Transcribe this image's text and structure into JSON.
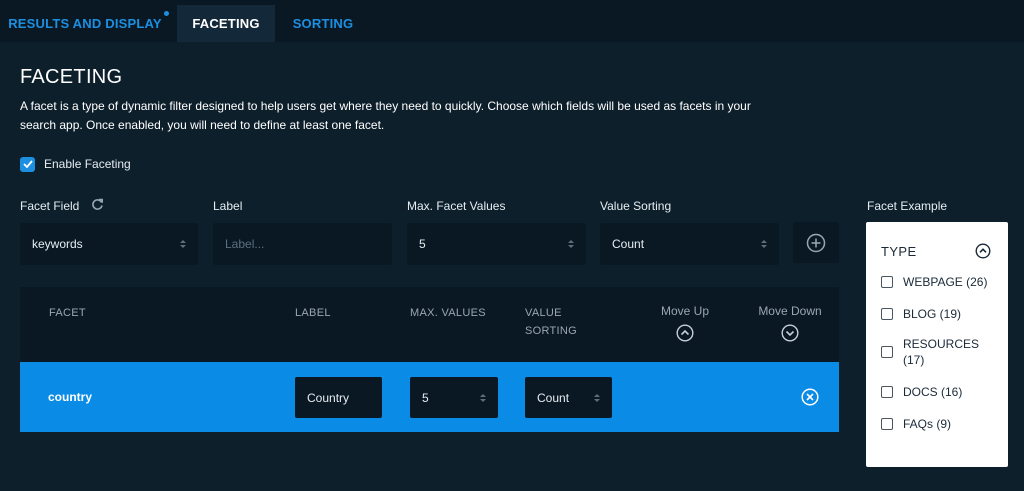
{
  "tabs": [
    {
      "label": "RESULTS AND DISPLAY",
      "has_indicator": true
    },
    {
      "label": "FACETING",
      "active": true
    },
    {
      "label": "SORTING"
    }
  ],
  "page": {
    "title": "FACETING",
    "description": "A facet is a type of dynamic filter designed to help users get where they need to quickly. Choose which fields will be used as facets in your search app. Once enabled, you will need to define at least one facet."
  },
  "enable": {
    "label": "Enable Faceting",
    "checked": true
  },
  "form": {
    "facet_field": {
      "label": "Facet Field",
      "value": "keywords"
    },
    "label": {
      "label": "Label",
      "placeholder": "Label..."
    },
    "max_values": {
      "label": "Max. Facet Values",
      "value": "5"
    },
    "value_sorting": {
      "label": "Value Sorting",
      "value": "Count"
    }
  },
  "table": {
    "headers": {
      "facet": "FACET",
      "label": "LABEL",
      "max_values": "MAX. VALUES",
      "value_sorting_1": "VALUE",
      "value_sorting_2": "SORTING",
      "move_up": "Move Up",
      "move_down": "Move Down"
    },
    "rows": [
      {
        "facet": "country",
        "label": "Country",
        "max_values": "5",
        "sorting": "Count"
      }
    ]
  },
  "example": {
    "section_label": "Facet Example",
    "title": "TYPE",
    "items": [
      {
        "label": "WEBPAGE (26)"
      },
      {
        "label_line1": "BLOG (19)"
      },
      {
        "label_line1": "RESOURCES",
        "label_line2": "(17)"
      },
      {
        "label_line1": "DOCS (16)"
      },
      {
        "label_line1": "FAQs (9)"
      }
    ]
  },
  "colors": {
    "background": "#0e1f2c",
    "accent": "#1d8fe1",
    "row_highlight": "#0a8be6",
    "input_bg": "#0a1824"
  },
  "icons": {
    "refresh": "refresh-icon",
    "add": "plus-circle-icon",
    "move_up": "chevron-up-circle-icon",
    "move_down": "chevron-down-circle-icon",
    "remove": "close-circle-icon",
    "collapse": "chevron-up-circle-icon"
  }
}
